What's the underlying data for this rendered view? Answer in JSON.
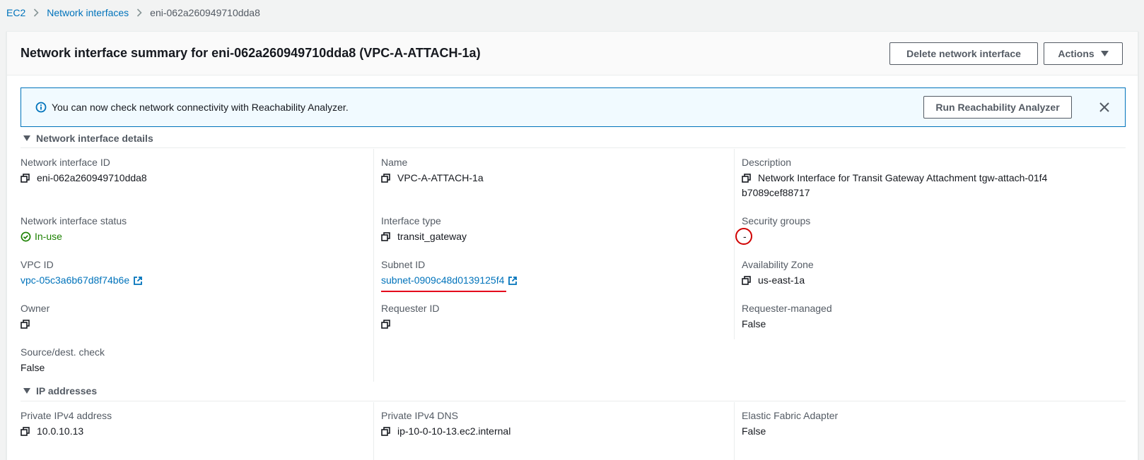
{
  "breadcrumb": {
    "items": [
      {
        "label": "EC2"
      },
      {
        "label": "Network interfaces"
      }
    ],
    "current": "eni-062a260949710dda8"
  },
  "header": {
    "title": "Network interface summary for eni-062a260949710dda8 (VPC-A-ATTACH-1a)",
    "delete_label": "Delete network interface",
    "actions_label": "Actions"
  },
  "alert": {
    "text": "You can now check network connectivity with Reachability Analyzer.",
    "button_label": "Run Reachability Analyzer"
  },
  "details": {
    "section_title": "Network interface details",
    "network_interface_id": {
      "label": "Network interface ID",
      "value": "eni-062a260949710dda8"
    },
    "name": {
      "label": "Name",
      "value": "VPC-A-ATTACH-1a"
    },
    "description": {
      "label": "Description",
      "value": "Network Interface for Transit Gateway Attachment tgw-attach-01f4b7089cef88717"
    },
    "status": {
      "label": "Network interface status",
      "value": "In-use"
    },
    "interface_type": {
      "label": "Interface type",
      "value": "transit_gateway"
    },
    "security_groups": {
      "label": "Security groups",
      "value": "-"
    },
    "vpc_id": {
      "label": "VPC ID",
      "value": "vpc-05c3a6b67d8f74b6e"
    },
    "subnet_id": {
      "label": "Subnet ID",
      "value": "subnet-0909c48d0139125f4"
    },
    "availability_zone": {
      "label": "Availability Zone",
      "value": "us-east-1a"
    },
    "owner": {
      "label": "Owner",
      "value": ""
    },
    "requester_id": {
      "label": "Requester ID",
      "value": ""
    },
    "requester_managed": {
      "label": "Requester-managed",
      "value": "False"
    },
    "source_dest_check": {
      "label": "Source/dest. check",
      "value": "False"
    }
  },
  "ip": {
    "section_title": "IP addresses",
    "private_ipv4": {
      "label": "Private IPv4 address",
      "value": "10.0.10.13"
    },
    "private_dns": {
      "label": "Private IPv4 DNS",
      "value": "ip-10-0-10-13.ec2.internal"
    },
    "efa": {
      "label": "Elastic Fabric Adapter",
      "value": "False"
    }
  },
  "colors": {
    "link": "#0073bb",
    "success": "#1d8102",
    "annotation": "#e4001b"
  }
}
